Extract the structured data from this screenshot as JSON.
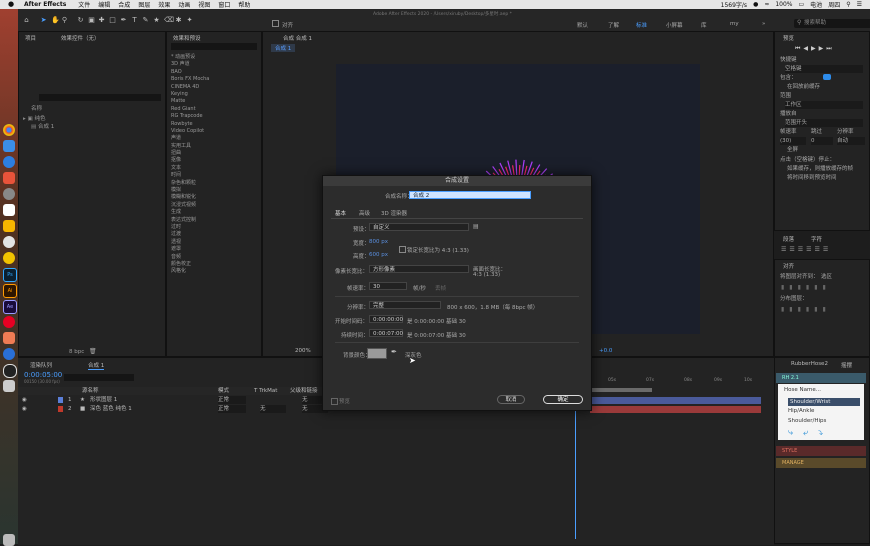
{
  "menubar": {
    "app": "After Effects",
    "items": [
      "文件",
      "编辑",
      "合成",
      "图层",
      "效果",
      "动画",
      "视图",
      "窗口",
      "帮助"
    ],
    "status": {
      "network": "1569字/s",
      "battery": "100%",
      "battery_label": "电池",
      "time": "周四"
    }
  },
  "toolbar": {
    "title": "Adobe After Effects 2020 - /Users/xiruby/Desktop/多星时.aep *",
    "snap_label": "对齐",
    "workspaces": [
      "默认",
      "了解",
      "标准",
      "小屏幕",
      "库",
      "my"
    ],
    "active_workspace": "标准",
    "search_help": "搜索帮助"
  },
  "project_panel": {
    "tabs": [
      "项目",
      "效果控件（无）"
    ],
    "column_name": "名称",
    "items": [
      {
        "name": "纯色",
        "type": "folder"
      },
      {
        "name": "合成 1",
        "type": "comp"
      }
    ],
    "bpc": "8 bpc"
  },
  "effects_panel": {
    "title": "效果和预设",
    "items": [
      "* 动画预设",
      "3D 声道",
      "BAO",
      "Boris FX Mocha",
      "CINEMA 4D",
      "Keying",
      "Matte",
      "Red Giant",
      "RG Trapcode",
      "Rowbyte",
      "Video Copilot",
      "声道",
      "实用工具",
      "扭曲",
      "抠像",
      "文本",
      "时间",
      "杂色和颗粒",
      "模拟",
      "模糊和锐化",
      "沉浸式视频",
      "生成",
      "表达式控制",
      "过时",
      "过渡",
      "透视",
      "遮罩",
      "音频",
      "颜色校正",
      "风格化"
    ]
  },
  "comp_panel": {
    "tab": "合成 合成 1",
    "subtab": "合成 1",
    "zoom": "200%",
    "offset": "+0.0"
  },
  "timeline": {
    "tabs": [
      "渲染队列",
      "合成 1"
    ],
    "timecode": "0:00:05:00",
    "timecode_sub": "00150 (30.00 fps)",
    "col_source": "源名称",
    "col_mode": "模式",
    "col_trkmat": "T TrkMat",
    "col_parent": "父级和链接",
    "layers": [
      {
        "num": "1",
        "name": "形状图层 1",
        "mode": "正常",
        "trk": "",
        "parent": "无",
        "color": "#5b7fd8"
      },
      {
        "num": "2",
        "name": "深色 蓝色 纯色 1",
        "mode": "正常",
        "trk": "无",
        "parent": "无",
        "color": "#c0392b"
      }
    ],
    "ruler": [
      "05s",
      "07s",
      "08s",
      "09s",
      "10s"
    ]
  },
  "preview_panel": {
    "title": "预览",
    "shortcut_label": "快捷键",
    "shortcut_value": "空格键",
    "include_label": "包含：",
    "cache_label": "在回放前缓存",
    "range_label": "范围",
    "range_value": "工作区",
    "play_from_label": "播放自",
    "play_from_value": "范围开头",
    "fps_label": "帧速率",
    "skip_label": "跳过",
    "res_label": "分辨率",
    "fps_value": "(30)",
    "skip_value": "0",
    "res_value": "自动",
    "fullscreen_label": "全屏",
    "stop_label": "点击（空格键）停止：",
    "opt1": "如果缓存，则播放缓存的帧",
    "opt2": "将时间移到预览时间"
  },
  "para_panel": {
    "tabs": [
      "段落",
      "字符"
    ]
  },
  "align_panel": {
    "title": "对齐",
    "align_to_label": "将图层对齐到：",
    "align_to_value": "选区",
    "distribute_label": "分布图层："
  },
  "rubberhose": {
    "tabs": [
      "RubberHose2",
      "摇摆"
    ],
    "version": "RH 2.1",
    "hose_name": "Hose Name...",
    "items": [
      "Shoulder/Wrist",
      "Hip/Ankle",
      "Shoulder/Hips"
    ],
    "style_label": "STYLE",
    "manage_label": "MANAGE"
  },
  "dialog": {
    "title": "合成设置",
    "name_label": "合成名称：",
    "name_value": "合成 2",
    "tabs": [
      "基本",
      "高级",
      "3D 渲染器"
    ],
    "preset_label": "预设：",
    "preset_value": "自定义",
    "width_label": "宽度：",
    "width_value": "800 px",
    "height_label": "高度：",
    "height_value": "600 px",
    "lock_label": "锁定长宽比为 4:3 (1.33)",
    "pixel_aspect_label": "像素长宽比：",
    "pixel_aspect_value": "方形像素",
    "frame_aspect_label": "画面长宽比：",
    "frame_aspect_value": "4:3 (1.33)",
    "fps_label": "帧速率：",
    "fps_value": "30",
    "fps_unit": "帧/秒",
    "drop_frame": "丢帧",
    "res_label": "分辨率：",
    "res_value": "完整",
    "res_info": "800 x 600，1.8 MB（每 8bpc 帧）",
    "start_label": "开始时间码：",
    "start_value": "0:00:00:00",
    "start_info": "是 0:00:00:00 基础 30",
    "dur_label": "持续时间：",
    "dur_value": "0:00:07:00",
    "dur_info": "是 0:00:07:00 基础 30",
    "bg_label": "背景颜色：",
    "bg_name": "深灰色",
    "preview_label": "预览",
    "cancel": "取消",
    "ok": "确定"
  },
  "colors": {
    "accent": "#2d8ceb",
    "bg_swatch": "#9a9a9a",
    "starburst_a": "#ff2a6d",
    "starburst_b": "#b040ff"
  }
}
